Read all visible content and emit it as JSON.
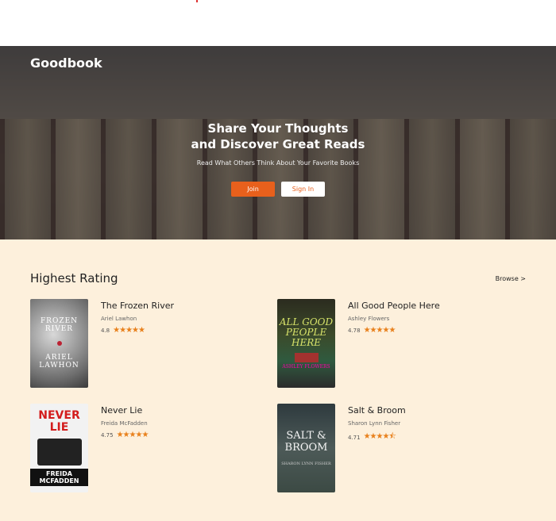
{
  "brand": "Goodbook",
  "hero": {
    "headline_line1": "Share Your Thoughts",
    "headline_line2": "and Discover Great Reads",
    "subtitle": "Read What Others Think About Your Favorite Books",
    "join_label": "Join",
    "signin_label": "Sign In"
  },
  "section": {
    "title": "Highest Rating",
    "browse_label": "Browse >"
  },
  "books": [
    {
      "title": "The Frozen River",
      "author": "Ariel Lawhon",
      "rating": "4.8",
      "stars": "★★★★★",
      "cover_title": "FROZEN RIVER",
      "cover_author": "ARIEL LAWHON"
    },
    {
      "title": "All Good People Here",
      "author": "Ashley Flowers",
      "rating": "4.78",
      "stars": "★★★★★",
      "cover_title": "ALL GOOD PEOPLE HERE",
      "cover_author": "ASHLEY FLOWERS"
    },
    {
      "title": "Never Lie",
      "author": "Freida McFadden",
      "rating": "4.75",
      "stars": "★★★★★",
      "cover_title": "NEVER LIE",
      "cover_author": "FREIDA MCFADDEN"
    },
    {
      "title": "Salt & Broom",
      "author": "Sharon Lynn Fisher",
      "rating": "4.71",
      "stars": "★★★★⯪",
      "cover_title": "SALT & BROOM",
      "cover_author": "SHARON LYNN FISHER"
    }
  ],
  "colors": {
    "accent": "#e8601c",
    "star": "#e8801c",
    "section_bg": "#fdf0dc"
  }
}
